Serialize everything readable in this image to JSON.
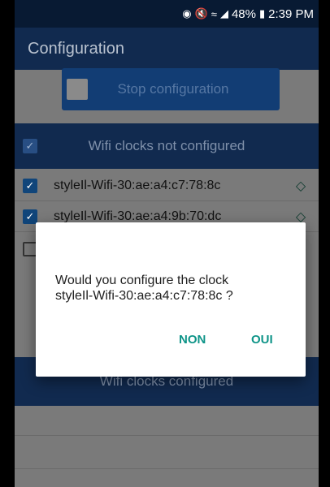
{
  "status_bar": {
    "location_icon": "location-icon",
    "mute_icon": "mute-icon",
    "wifi_icon": "wifi-icon",
    "signal_icon": "signal-icon",
    "battery_percent": "48%",
    "battery_icon": "battery-icon",
    "time": "2:39 PM"
  },
  "app_bar": {
    "title": "Configuration"
  },
  "stop_button": {
    "label": "Stop configuration"
  },
  "not_configured_section": {
    "label": "Wifi clocks not configured",
    "checked": true
  },
  "clocks": [
    {
      "name": "styleIl-Wifi-30:ae:a4:c7:78:8c",
      "checked": true
    },
    {
      "name": "styleIl-Wifi-30:ae:a4:9b:70:dc",
      "checked": true
    },
    {
      "name": "",
      "checked": false
    }
  ],
  "configured_section": {
    "label": "Wifi clocks configured"
  },
  "dialog": {
    "message_line1": "Would you configure the clock",
    "message_line2": "styleIl-Wifi-30:ae:a4:c7:78:8c ?",
    "negative_label": "NON",
    "positive_label": "OUI"
  },
  "colors": {
    "app_bar": "#112a4f",
    "status_bar": "#081a33",
    "dialog_button": "#0e9488",
    "scrim_grey": "#7a7a7a"
  }
}
